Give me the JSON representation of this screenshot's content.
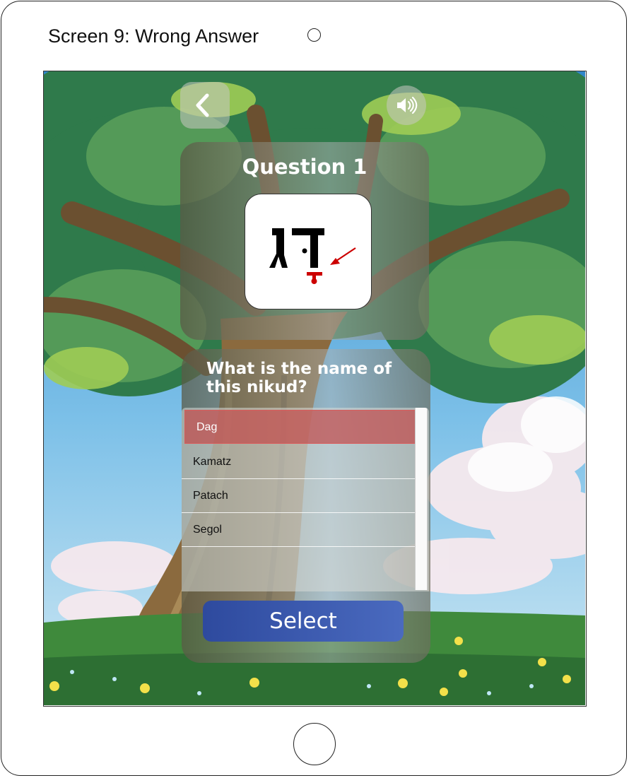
{
  "screen": {
    "label": "Screen 9: Wrong Answer"
  },
  "question": {
    "title": "Question 1",
    "prompt": "What is the name of this nikud?"
  },
  "answers": [
    {
      "label": "Dag",
      "state": "wrong"
    },
    {
      "label": "Kamatz",
      "state": "default"
    },
    {
      "label": "Patach",
      "state": "default"
    },
    {
      "label": "Segol",
      "state": "default"
    }
  ],
  "select_button": {
    "label": "Select"
  },
  "icons": {
    "back": "chevron-left-icon",
    "sound": "speaker-icon",
    "arrow": "red-arrow-icon"
  },
  "colors": {
    "wrong_highlight": "#c34646",
    "select_button": "#3a58ad",
    "nikud_marker": "#cc0000"
  }
}
